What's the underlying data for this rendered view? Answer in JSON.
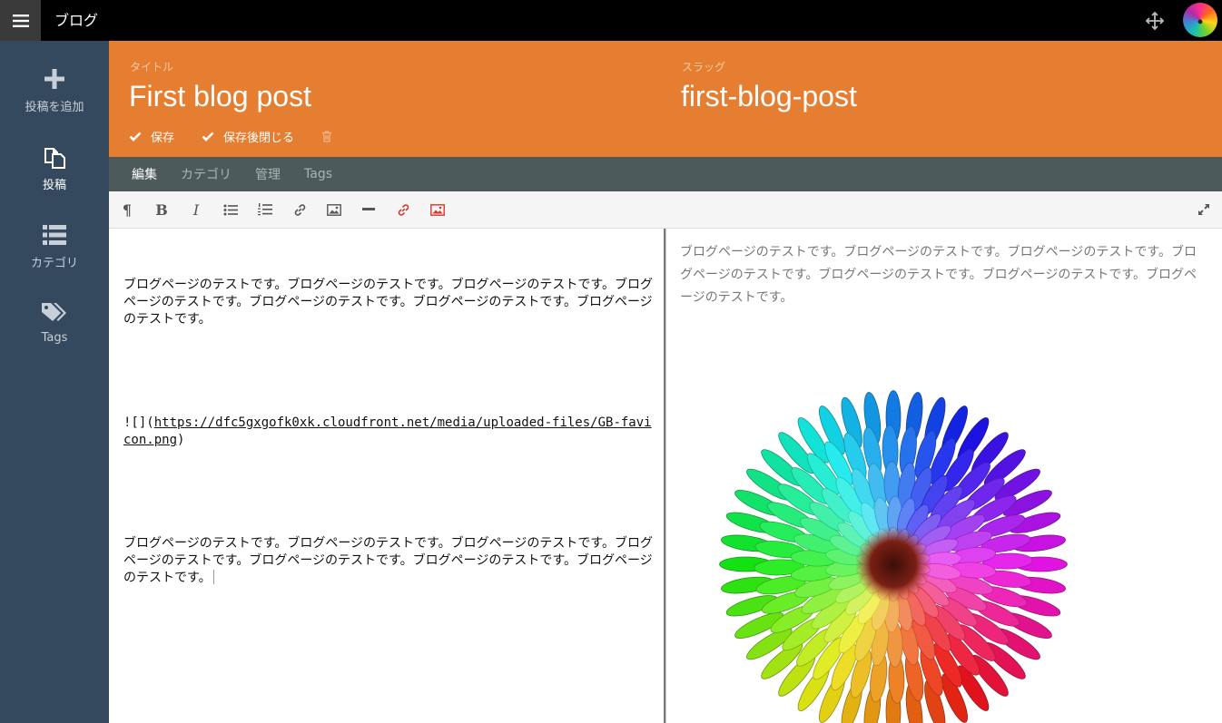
{
  "app": {
    "title": "ブログ"
  },
  "sidebar": {
    "items": [
      {
        "label": "投稿を追加",
        "icon": "plus-icon"
      },
      {
        "label": "投稿",
        "icon": "copy-icon"
      },
      {
        "label": "カテゴリ",
        "icon": "list-icon"
      },
      {
        "label": "Tags",
        "icon": "tags-icon"
      }
    ]
  },
  "header": {
    "title_label": "タイトル",
    "title_value": "First blog post",
    "slug_label": "スラッグ",
    "slug_value": "first-blog-post",
    "save_label": "保存",
    "save_close_label": "保存後閉じる"
  },
  "tabs": [
    "編集",
    "カテゴリ",
    "管理",
    "Tags"
  ],
  "toolbar": {
    "icons": [
      "paragraph-icon",
      "bold-icon",
      "italic-icon",
      "bullet-list-icon",
      "numbered-list-icon",
      "link-icon",
      "image-icon",
      "horizontal-rule-icon",
      "unlink-icon",
      "remove-image-icon",
      "fullscreen-icon"
    ]
  },
  "editor": {
    "para1": "ブログページのテストです。ブログページのテストです。ブログページのテストです。ブログページのテストです。ブログページのテストです。ブログページのテストです。ブログページのテストです。",
    "img_prefix": "![](",
    "img_url": "https://dfc5gxgofk0xk.cloudfront.net/media/uploaded-files/GB-favicon.png",
    "img_suffix": ")",
    "para2": "ブログページのテストです。ブログページのテストです。ブログページのテストです。ブログページのテストです。ブログページのテストです。ブログページのテストです。ブログページのテストです。"
  },
  "preview": {
    "text": "ブログページのテストです。ブログページのテストです。ブログページのテストです。ブログページのテストです。ブログページのテストです。ブログページのテストです。ブログページのテストです。"
  },
  "colors": {
    "accent": "#e67e32",
    "sidebar": "#34495e",
    "tabs_bar": "#4d5a5b",
    "link_red": "#d9382e"
  }
}
